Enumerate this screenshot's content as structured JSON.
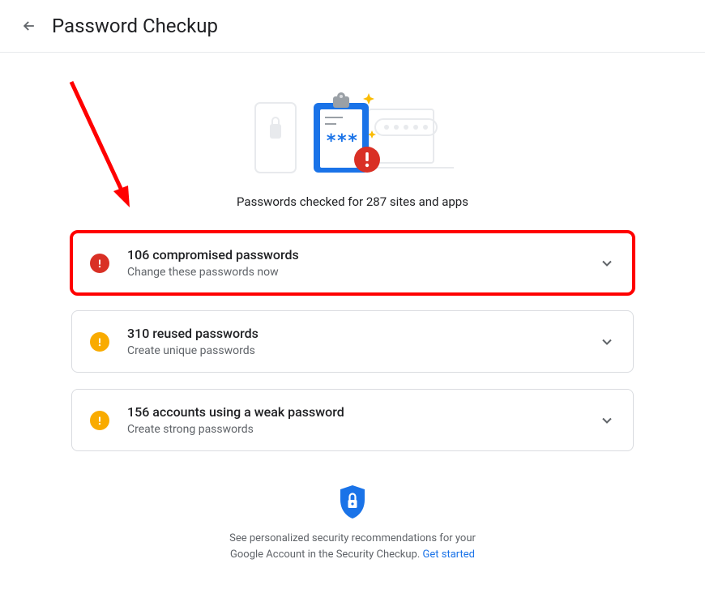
{
  "header": {
    "title": "Password Checkup"
  },
  "summary": "Passwords checked for 287 sites and apps",
  "cards": [
    {
      "severity": "red",
      "title": "106 compromised passwords",
      "subtitle": "Change these passwords now",
      "highlighted": true
    },
    {
      "severity": "yellow",
      "title": "310 reused passwords",
      "subtitle": "Create unique passwords",
      "highlighted": false
    },
    {
      "severity": "yellow",
      "title": "156 accounts using a weak password",
      "subtitle": "Create strong passwords",
      "highlighted": false
    }
  ],
  "footer": {
    "text": "See personalized security recommendations for your Google Account in the Security Checkup. ",
    "link": "Get started"
  }
}
